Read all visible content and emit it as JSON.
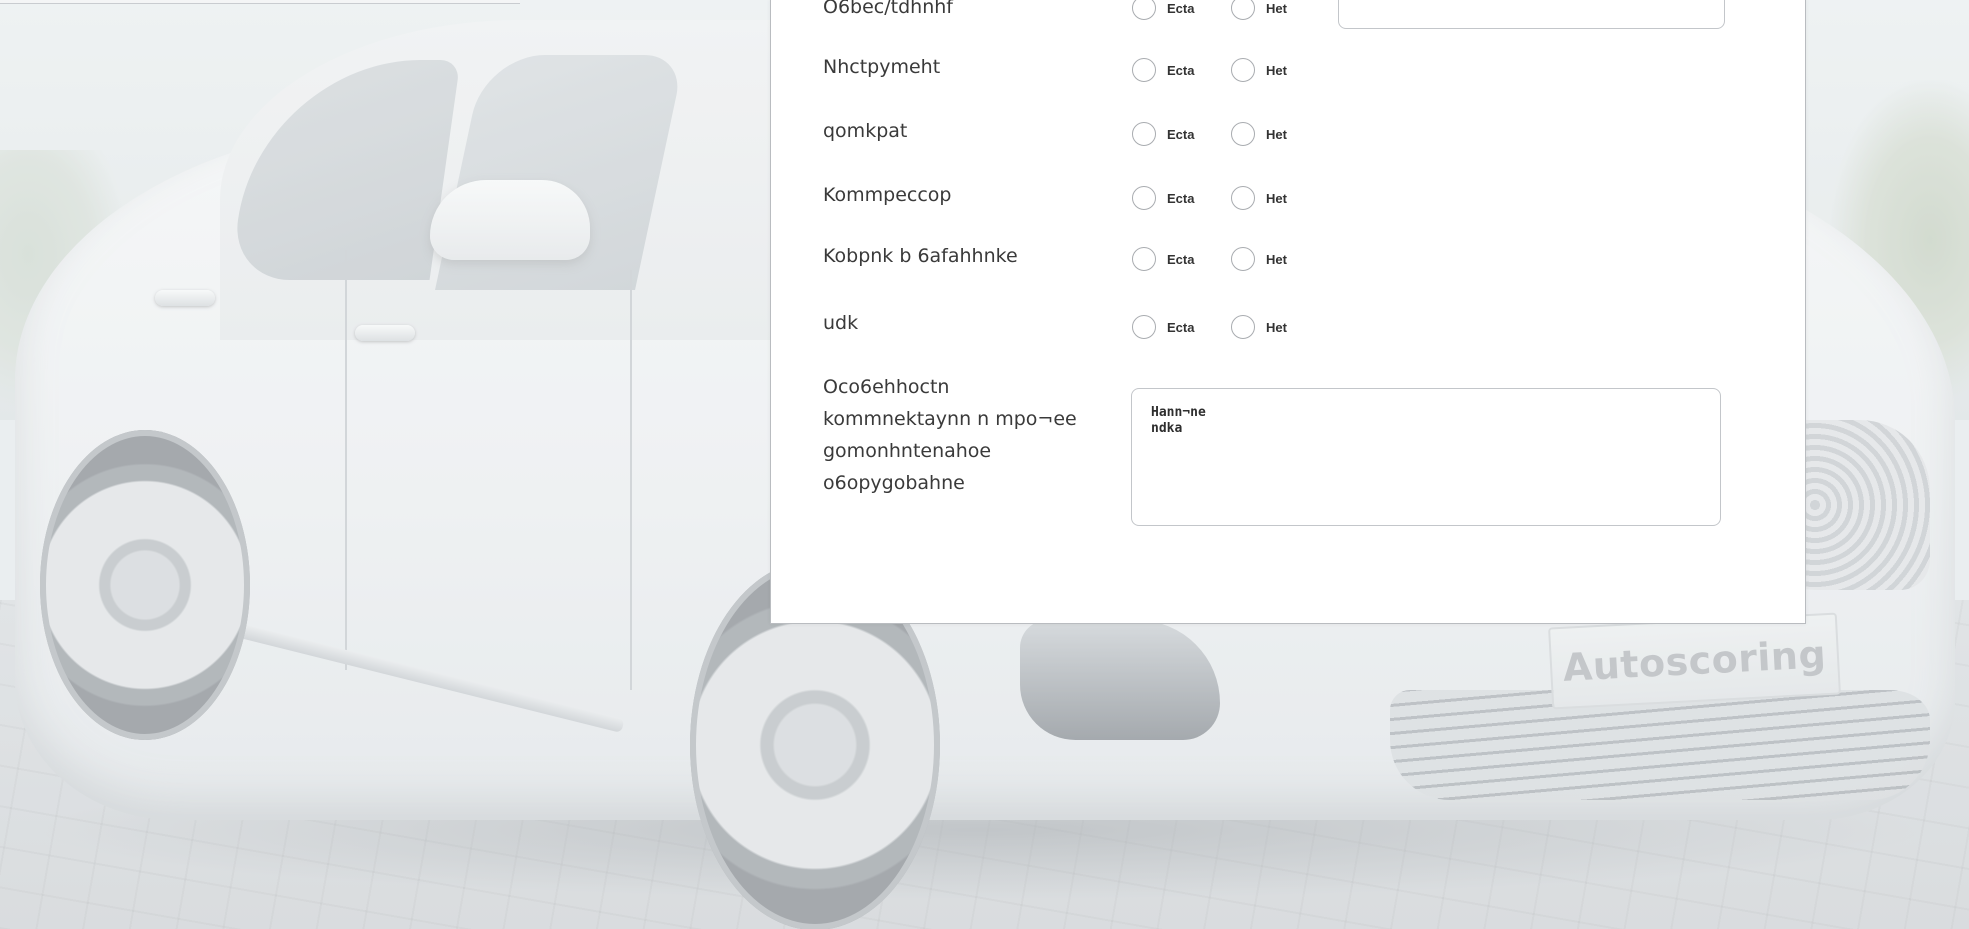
{
  "background": {
    "plate_text": "Autoscoring"
  },
  "form": {
    "rows": [
      {
        "id": "obvestnik",
        "label": "O6bec/tdhnhf",
        "yes": "Ecta",
        "no": "Het"
      },
      {
        "id": "instrument",
        "label": "Nhctpymeht",
        "yes": "Ecta",
        "no": "Het"
      },
      {
        "id": "domkrat",
        "label": "qomkpat",
        "yes": "Ecta",
        "no": "Het"
      },
      {
        "id": "compressor",
        "label": "Kommpeccop",
        "yes": "Ecta",
        "no": "Het"
      },
      {
        "id": "kovrik",
        "label": "Kobpnk b 6afahhnke",
        "yes": "Ecta",
        "no": "Het"
      },
      {
        "id": "udk",
        "label": "udk",
        "yes": "Ecta",
        "no": "Het"
      }
    ],
    "notes": {
      "label_lines": [
        "Oco6ehhoctn",
        "kommnektaynn n mpo¬ee",
        "gomonhntenahoe",
        "o6opygobahne"
      ],
      "value": "Hann¬ne\nndka"
    }
  }
}
